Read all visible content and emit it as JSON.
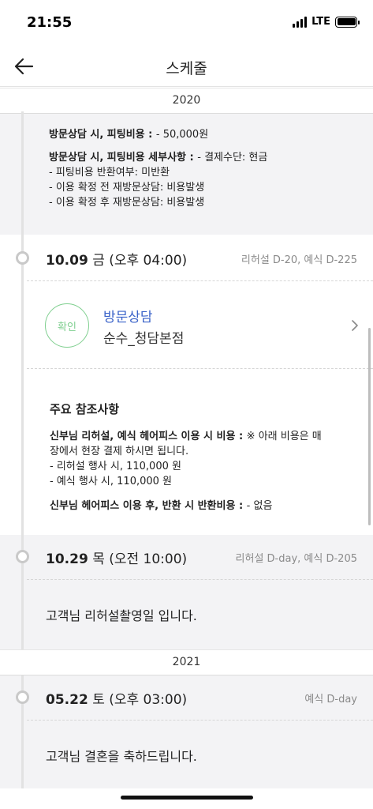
{
  "status_bar": {
    "time": "21:55",
    "network": "LTE"
  },
  "nav": {
    "title": "스케줄",
    "back_icon": "arrow-left-icon"
  },
  "years": [
    "2020",
    "2021"
  ],
  "top_details": {
    "fee_label": "방문상담 시, 피팅비용 : ",
    "fee_value": "- 50,000원",
    "detail_label": "방문상담 시, 피팅비용 세부사항 : ",
    "detail_value": "- 결제수단: 현금",
    "lines": [
      "- 피팅비용 반환여부: 미반환",
      "- 이용 확정 전 재방문상담: 비용발생",
      "- 이용 확정 후 재방문상담: 비용발생"
    ]
  },
  "events": [
    {
      "date": "10.09",
      "weekday": "금",
      "time": "(오후 04:00)",
      "dday": "리허설 D-20, 예식 D-225",
      "status": "확인",
      "title": "방문상담",
      "place": "순수_청담본점"
    },
    {
      "date": "10.29",
      "weekday": "목",
      "time": "(오전 10:00)",
      "dday": "리허설 D-day, 예식 D-205",
      "message": "고객님 리허설촬영일 입니다."
    },
    {
      "date": "05.22",
      "weekday": "토",
      "time": "(오후 03:00)",
      "dday": "예식 D-day",
      "message": "고객님 결혼을 축하드립니다."
    }
  ],
  "reference": {
    "title": "주요 참조사항",
    "hairpiece_label": "신부님 리허설, 예식 헤어피스 이용 시 비용 : ",
    "hairpiece_value": "※ 아래 비용은 매",
    "hairpiece_line2": "장에서 현장 결제 하시면 됩니다.",
    "hairpiece_lines": [
      "- 리허설 행사 시, 110,000 원",
      "- 예식 행사 시, 110,000 원"
    ],
    "return_label": "신부님 헤어피스 이용 후, 반환 시 반환비용 : ",
    "return_value": "- 없음"
  }
}
